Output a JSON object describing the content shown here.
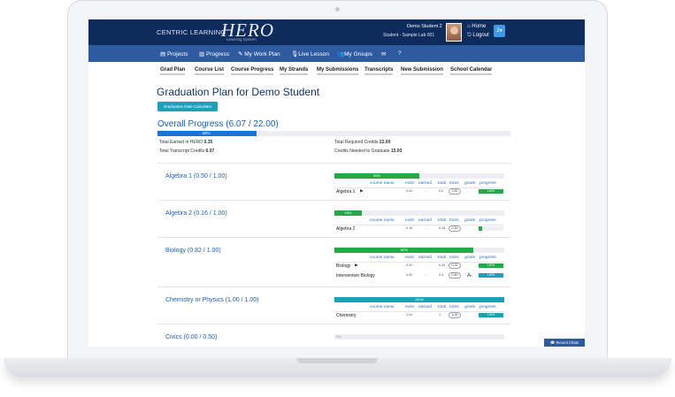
{
  "header": {
    "brand_left": "CENTRIC LEARNING",
    "brand_hero": "HERO",
    "brand_sub": "Learning System",
    "user_name": "Demo Student 2",
    "user_role": "Student - Sample Lab 001",
    "home_label": "Home",
    "logout_label": "Logout",
    "count_label": "2"
  },
  "nav": {
    "items": [
      "Projects",
      "Progress",
      "My Work Plan",
      "Live Lesson",
      "My Groups",
      "✉",
      "?"
    ]
  },
  "subtabs": [
    "Grad Plan",
    "Course List",
    "Course Progress",
    "My Strands",
    "My Submissions",
    "Transcripts",
    "New Submission",
    "School Calendar"
  ],
  "page": {
    "title": "Graduation Plan for Demo Student",
    "calc_button": "Graduation Date Calculator",
    "overall_title": "Overall Progress (6.07 / 22.00)",
    "overall_percent_label": "28%",
    "overall_percent": 28
  },
  "stats": {
    "earned_hero_label": "Total Earned in HERO",
    "earned_hero_value": "0.35",
    "transcript_label": "Total Transcript Credits",
    "transcript_value": "6.07",
    "required_label": "Total Required Credits",
    "required_value": "22.00",
    "needed_label": "Credits Needed to Graduate",
    "needed_value": "15.93"
  },
  "columns": {
    "course_name": "course name",
    "exist": "exist",
    "earned": "earned",
    "total": "total",
    "trans": "trans",
    "grade": "grade",
    "progress": "progress"
  },
  "courses": [
    {
      "title": "Algebra 1 (0.50 / 1.00)",
      "bar_label": "50%",
      "bar_percent": 50,
      "bar_color": "#28a745",
      "rows": [
        {
          "name": "Algebra 1",
          "exist": "0.50",
          "earned": "-",
          "total": "0.5",
          "trans": "0.50",
          "grade": "",
          "progress_label": "100%",
          "progress": 100,
          "progress_color": "#28a745"
        }
      ]
    },
    {
      "title": "Algebra 2 (0.16 / 1.00)",
      "bar_label": "16%",
      "bar_percent": 16,
      "bar_color": "#28a745",
      "rows": [
        {
          "name": "Algebra 2",
          "exist": "0.16",
          "earned": "-",
          "total": "0.16",
          "trans": "0.16",
          "grade": "",
          "progress_label": "",
          "progress": 16,
          "progress_color": "#28a745"
        }
      ]
    },
    {
      "title": "Biology (0.82 / 1.00)",
      "bar_label": "82%",
      "bar_percent": 82,
      "bar_color": "#28a745",
      "rows": [
        {
          "name": "Biology",
          "exist": "0.32",
          "earned": "-",
          "total": "0.32",
          "trans": "0.32",
          "grade": "",
          "progress_label": "100%",
          "progress": 100,
          "progress_color": "#28a745"
        },
        {
          "name": "Intervention Biology",
          "exist": "0.50",
          "earned": "-",
          "total": "0.5",
          "trans": "0.50",
          "grade": "A-",
          "progress_label": "100%",
          "progress": 100,
          "progress_color": "#20a0b7"
        }
      ]
    },
    {
      "title": "Chemistry or Physics (1.00 / 1.00)",
      "bar_label": "100%",
      "bar_percent": 100,
      "bar_color": "#20a0b7",
      "rows": [
        {
          "name": "Chemistry",
          "exist": "1.00",
          "earned": "-",
          "total": "1",
          "trans": "1.00",
          "grade": "",
          "progress_label": "100%",
          "progress": 100,
          "progress_color": "#20a0b7"
        }
      ]
    },
    {
      "title": "Civics (0.00 / 0.50)",
      "bar_label": "0%",
      "bar_percent": 0,
      "bar_color": "#28a745",
      "rows": []
    }
  ],
  "chat": {
    "label": "Recent Chats"
  }
}
